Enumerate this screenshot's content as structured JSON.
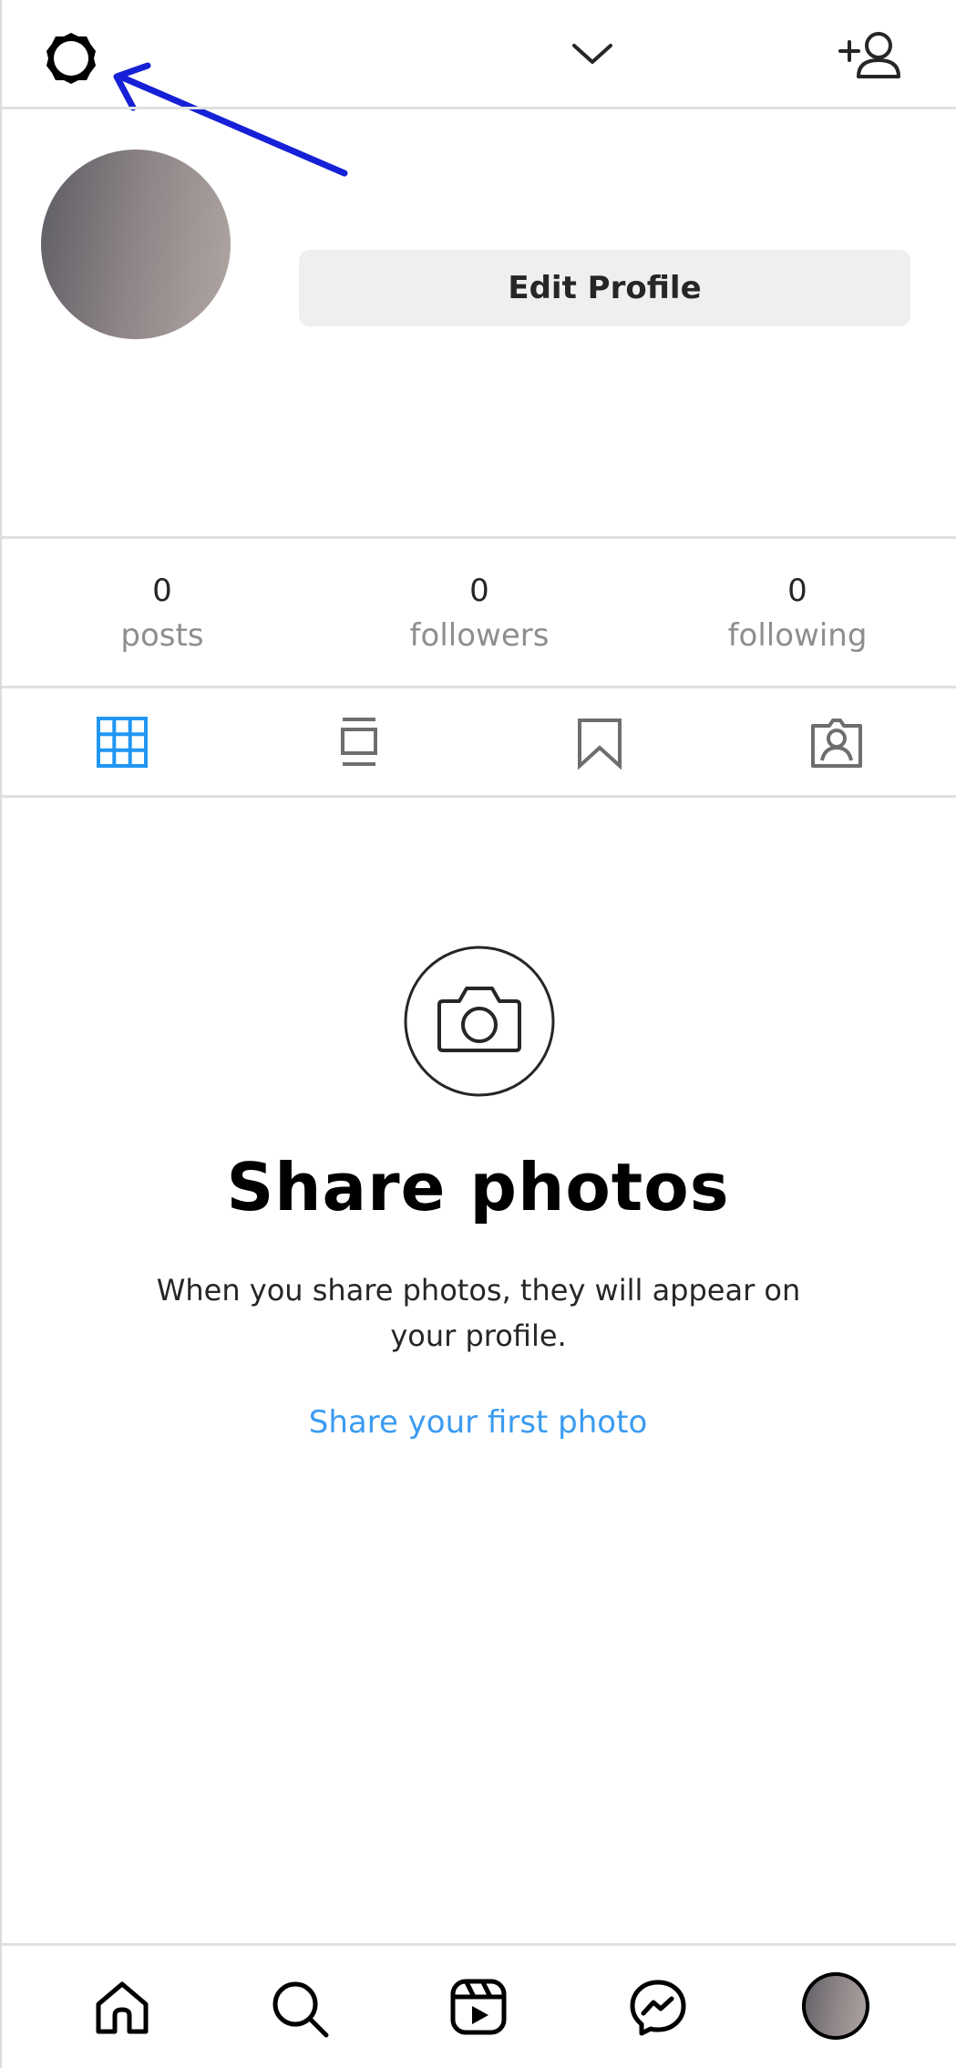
{
  "header": {
    "settings_icon": "gear-icon",
    "account_switch_icon": "chevron-down-icon",
    "add_user_icon": "add-user-icon",
    "annotation_arrow_color": "#1620d6"
  },
  "profile": {
    "edit_button_label": "Edit Profile"
  },
  "stats": [
    {
      "value": "0",
      "label": "posts"
    },
    {
      "value": "0",
      "label": "followers"
    },
    {
      "value": "0",
      "label": "following"
    }
  ],
  "tabs": [
    {
      "icon": "grid-icon",
      "active": true
    },
    {
      "icon": "feed-icon",
      "active": false
    },
    {
      "icon": "saved-icon",
      "active": false
    },
    {
      "icon": "tagged-icon",
      "active": false
    }
  ],
  "empty_state": {
    "icon": "camera-icon",
    "title": "Share photos",
    "description": "When you share photos, they will appear on your profile.",
    "link": "Share your first photo"
  },
  "bottom_nav": [
    {
      "icon": "home-icon"
    },
    {
      "icon": "search-icon"
    },
    {
      "icon": "reels-icon"
    },
    {
      "icon": "messenger-icon"
    },
    {
      "icon": "profile-avatar"
    }
  ],
  "colors": {
    "accent": "#0095f6",
    "link": "#3b9bf1",
    "active_tab": "#2196f3",
    "muted_text": "#8e8e8e"
  }
}
